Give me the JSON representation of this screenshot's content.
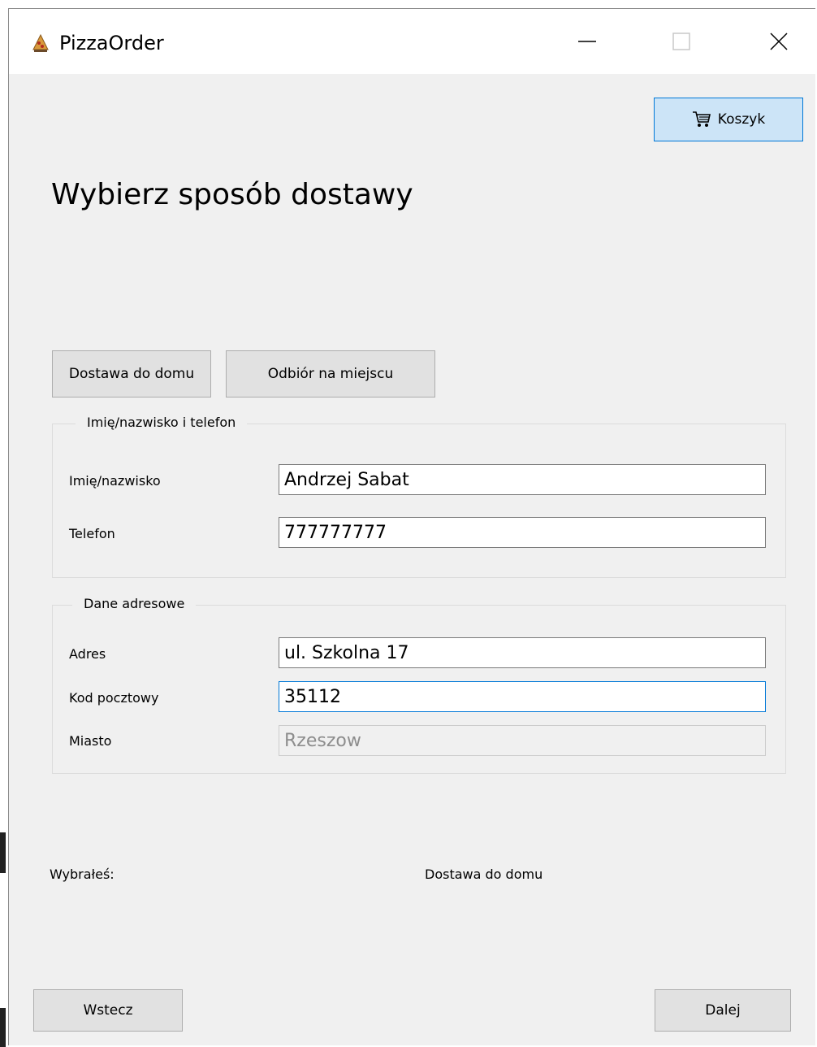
{
  "window": {
    "title": "PizzaOrder",
    "app_icon": "pizza-icon",
    "controls": {
      "minimize_icon": "minimize-icon",
      "maximize_icon": "maximize-icon",
      "close_icon": "close-icon"
    }
  },
  "header": {
    "cart_label": "Koszyk",
    "cart_icon": "cart-icon",
    "title": "Wybierz sposób dostawy"
  },
  "delivery_options": {
    "home_label": "Dostawa do domu",
    "pickup_label": "Odbiór na miejscu"
  },
  "personal_group": {
    "legend": "Imię/nazwisko i telefon",
    "name_label": "Imię/nazwisko",
    "name_value": "Andrzej Sabat",
    "phone_label": "Telefon",
    "phone_value": "777777777"
  },
  "address_group": {
    "legend": "Dane adresowe",
    "address_label": "Adres",
    "address_value": "ul. Szkolna 17",
    "postal_label": "Kod pocztowy",
    "postal_value": "35112",
    "city_label": "Miasto",
    "city_value": "Rzeszow"
  },
  "summary": {
    "label": "Wybrałeś:",
    "value": "Dostawa do domu"
  },
  "footer": {
    "back_label": "Wstecz",
    "next_label": "Dalej"
  },
  "colors": {
    "window_bg": "#f0f0f0",
    "button_bg": "#e1e1e1",
    "accent_border": "#0078d7",
    "accent_bg": "#cce4f7"
  }
}
